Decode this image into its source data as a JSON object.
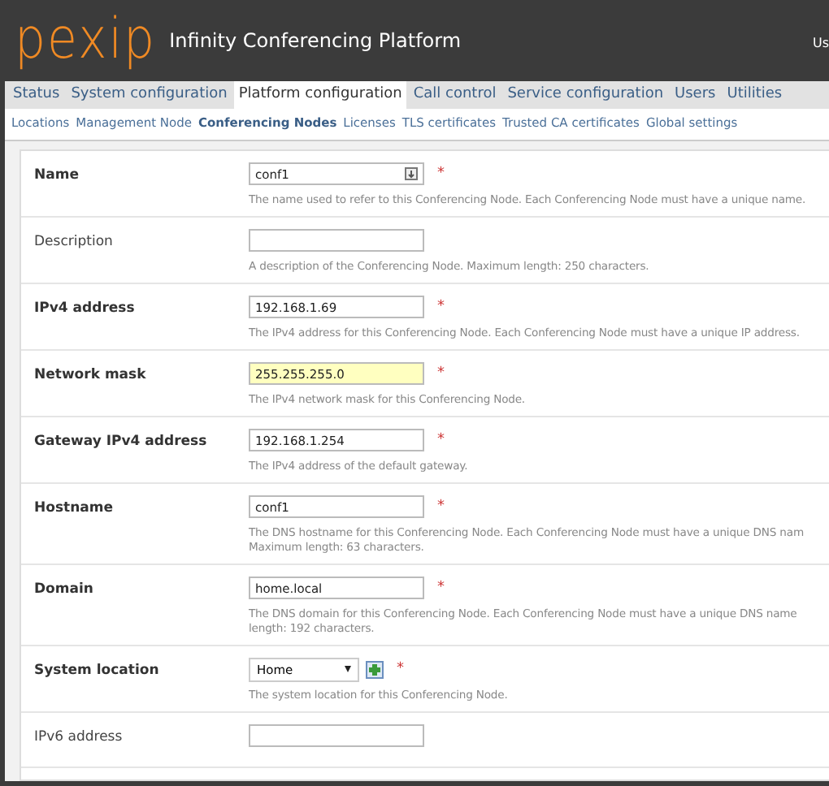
{
  "header": {
    "logo": "pexip",
    "title": "Infinity Conferencing Platform",
    "user_cut": "Us"
  },
  "tabs": [
    {
      "label": "Status",
      "selected": false
    },
    {
      "label": "System configuration",
      "selected": false
    },
    {
      "label": "Platform configuration",
      "selected": true
    },
    {
      "label": "Call control",
      "selected": false
    },
    {
      "label": "Service configuration",
      "selected": false
    },
    {
      "label": "Users",
      "selected": false
    },
    {
      "label": "Utilities",
      "selected": false
    }
  ],
  "subnav": [
    {
      "label": "Locations",
      "selected": false
    },
    {
      "label": "Management Node",
      "selected": false
    },
    {
      "label": "Conferencing Nodes",
      "selected": true
    },
    {
      "label": "Licenses",
      "selected": false
    },
    {
      "label": "TLS certificates",
      "selected": false
    },
    {
      "label": "Trusted CA certificates",
      "selected": false
    },
    {
      "label": "Global settings",
      "selected": false
    }
  ],
  "form": [
    {
      "label": "Name",
      "kind": "text",
      "required": true,
      "marker": "*",
      "value": "conf1",
      "has_icon": true,
      "help": [
        "The name used to refer to this Conferencing Node. Each Conferencing Node must have a unique name."
      ]
    },
    {
      "label": "Description",
      "kind": "text",
      "required": false,
      "help": [
        "A description of the Conferencing Node. Maximum length: 250 characters."
      ]
    },
    {
      "label": "IPv4 address",
      "kind": "text",
      "required": true,
      "marker": "*",
      "value": "192.168.1.69",
      "help": [
        "The IPv4 address for this Conferencing Node. Each Conferencing Node must have a unique IP address."
      ]
    },
    {
      "label": "Network mask",
      "kind": "text",
      "required": true,
      "marker": "*",
      "value": "255.255.255.0",
      "highlighted": true,
      "help": [
        "The IPv4 network mask for this Conferencing Node."
      ]
    },
    {
      "label": "Gateway IPv4 address",
      "kind": "text",
      "required": true,
      "marker": "*",
      "value": "192.168.1.254",
      "help": [
        "The IPv4 address of the default gateway."
      ]
    },
    {
      "label": "Hostname",
      "kind": "text",
      "required": true,
      "marker": "*",
      "value": "conf1",
      "help": [
        "The DNS hostname for this Conferencing Node. Each Conferencing Node must have a unique DNS nam",
        "Maximum length: 63 characters."
      ]
    },
    {
      "label": "Domain",
      "kind": "text",
      "required": true,
      "marker": "*",
      "value": "home.local",
      "help": [
        "The DNS domain for this Conferencing Node. Each Conferencing Node must have a unique DNS name",
        "length: 192 characters."
      ]
    },
    {
      "label": "System location",
      "kind": "select",
      "required": true,
      "marker": "*",
      "value": "Home",
      "help": [
        "The system location for this Conferencing Node."
      ]
    },
    {
      "label": "IPv6 address",
      "kind": "text",
      "required": false
    }
  ]
}
